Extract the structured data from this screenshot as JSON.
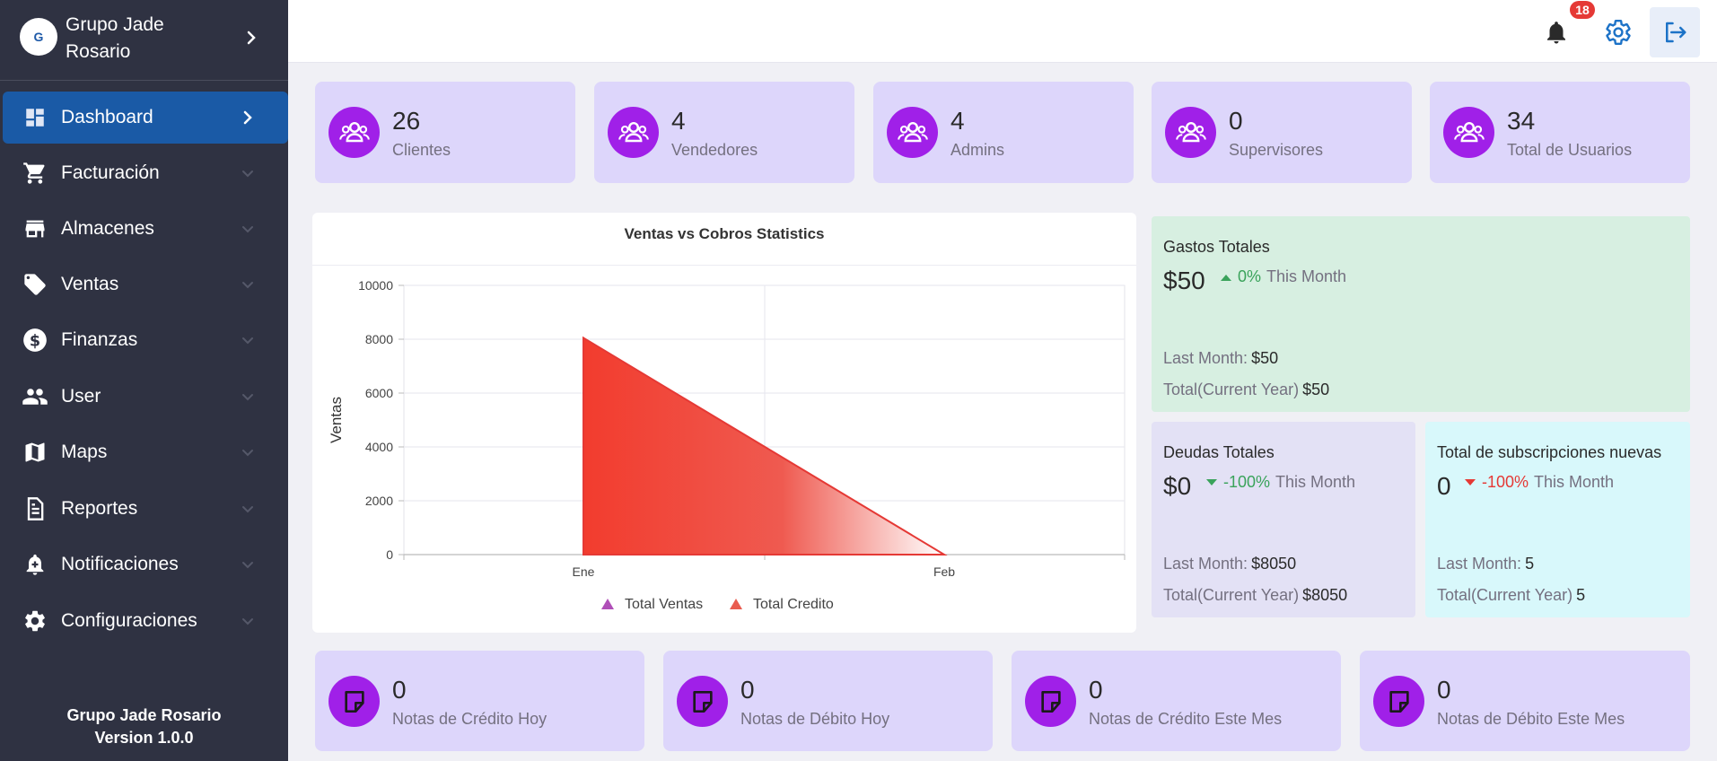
{
  "sidebar": {
    "brand_name": "Grupo Jade Rosario",
    "logo_text": "G",
    "items": [
      {
        "label": "Dashboard",
        "icon": "dashboard-icon"
      },
      {
        "label": "Facturación",
        "icon": "cart-icon"
      },
      {
        "label": "Almacenes",
        "icon": "store-icon"
      },
      {
        "label": "Ventas",
        "icon": "tag-icon"
      },
      {
        "label": "Finanzas",
        "icon": "dollar-icon"
      },
      {
        "label": "User",
        "icon": "users-icon"
      },
      {
        "label": "Maps",
        "icon": "map-icon"
      },
      {
        "label": "Reportes",
        "icon": "report-icon"
      },
      {
        "label": "Notificaciones",
        "icon": "bell-plus-icon"
      },
      {
        "label": "Configuraciones",
        "icon": "gear-icon"
      }
    ],
    "footer_line1": "Grupo Jade Rosario",
    "footer_line2": "Version 1.0.0"
  },
  "header": {
    "notification_count": "18"
  },
  "stats": [
    {
      "value": "26",
      "label": "Clientes"
    },
    {
      "value": "4",
      "label": "Vendedores"
    },
    {
      "value": "4",
      "label": "Admins"
    },
    {
      "value": "0",
      "label": "Supervisores"
    },
    {
      "value": "34",
      "label": "Total de Usuarios"
    }
  ],
  "chart_data": {
    "type": "area",
    "title": "Ventas vs Cobros Statistics",
    "xlabel": "",
    "ylabel": "Ventas",
    "categories": [
      "Ene",
      "Feb"
    ],
    "ylim": [
      0,
      10000
    ],
    "yticks": [
      "0",
      "2000",
      "4000",
      "6000",
      "8000",
      "10000"
    ],
    "series": [
      {
        "name": "Total Ventas",
        "values": [
          0,
          0
        ],
        "color": "#9b4fb0"
      },
      {
        "name": "Total Credito",
        "values": [
          8050,
          0
        ],
        "color": "#e53935"
      }
    ],
    "grid": true,
    "legend": "bottom"
  },
  "kpis": {
    "gastos": {
      "title": "Gastos Totales",
      "amount": "$50",
      "pct": "0%",
      "period": "This Month",
      "last_month_label": "Last Month:",
      "last_month": "$50",
      "year_label": "Total(Current Year)",
      "year": "$50",
      "color": "#d7efe1"
    },
    "deudas": {
      "title": "Deudas Totales",
      "amount": "$0",
      "pct": "-100%",
      "period": "This Month",
      "last_month_label": "Last Month:",
      "last_month": "$8050",
      "year_label": "Total(Current Year)",
      "year": "$8050",
      "color": "#e3e1f5"
    },
    "subs": {
      "title": "Total de subscripciones nuevas",
      "amount": "0",
      "pct": "-100%",
      "period": "This Month",
      "last_month_label": "Last Month:",
      "last_month": "5",
      "year_label": "Total(Current Year)",
      "year": "5",
      "color": "#d8f8fb"
    }
  },
  "notes": [
    {
      "value": "0",
      "label": "Notas de Crédito Hoy"
    },
    {
      "value": "0",
      "label": "Notas de Débito Hoy"
    },
    {
      "value": "0",
      "label": "Notas de Crédito Este Mes"
    },
    {
      "value": "0",
      "label": "Notas de Débito Este Mes"
    }
  ]
}
